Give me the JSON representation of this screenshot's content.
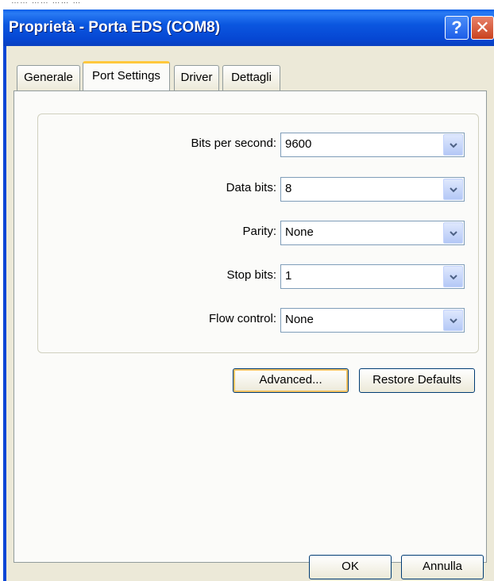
{
  "window": {
    "title": "Proprietà - Porta EDS (COM8)",
    "help_label": "?",
    "close_label": "✕"
  },
  "tabs": [
    {
      "label": "Generale"
    },
    {
      "label": "Port Settings"
    },
    {
      "label": "Driver"
    },
    {
      "label": "Dettagli"
    }
  ],
  "active_tab": "Port Settings",
  "fields": {
    "bits_per_second": {
      "label": "Bits per second:",
      "value": "9600"
    },
    "data_bits": {
      "label": "Data bits:",
      "value": "8"
    },
    "parity": {
      "label": "Parity:",
      "value": "None"
    },
    "stop_bits": {
      "label": "Stop bits:",
      "value": "1"
    },
    "flow_control": {
      "label": "Flow control:",
      "value": "None"
    }
  },
  "buttons": {
    "advanced": "Advanced...",
    "restore_defaults": "Restore Defaults",
    "ok": "OK",
    "cancel": "Annulla"
  },
  "colors": {
    "titlebar": "#0a5ee8",
    "face": "#ece9d8",
    "default_ring": "#f4c363",
    "close": "#c9421f"
  }
}
